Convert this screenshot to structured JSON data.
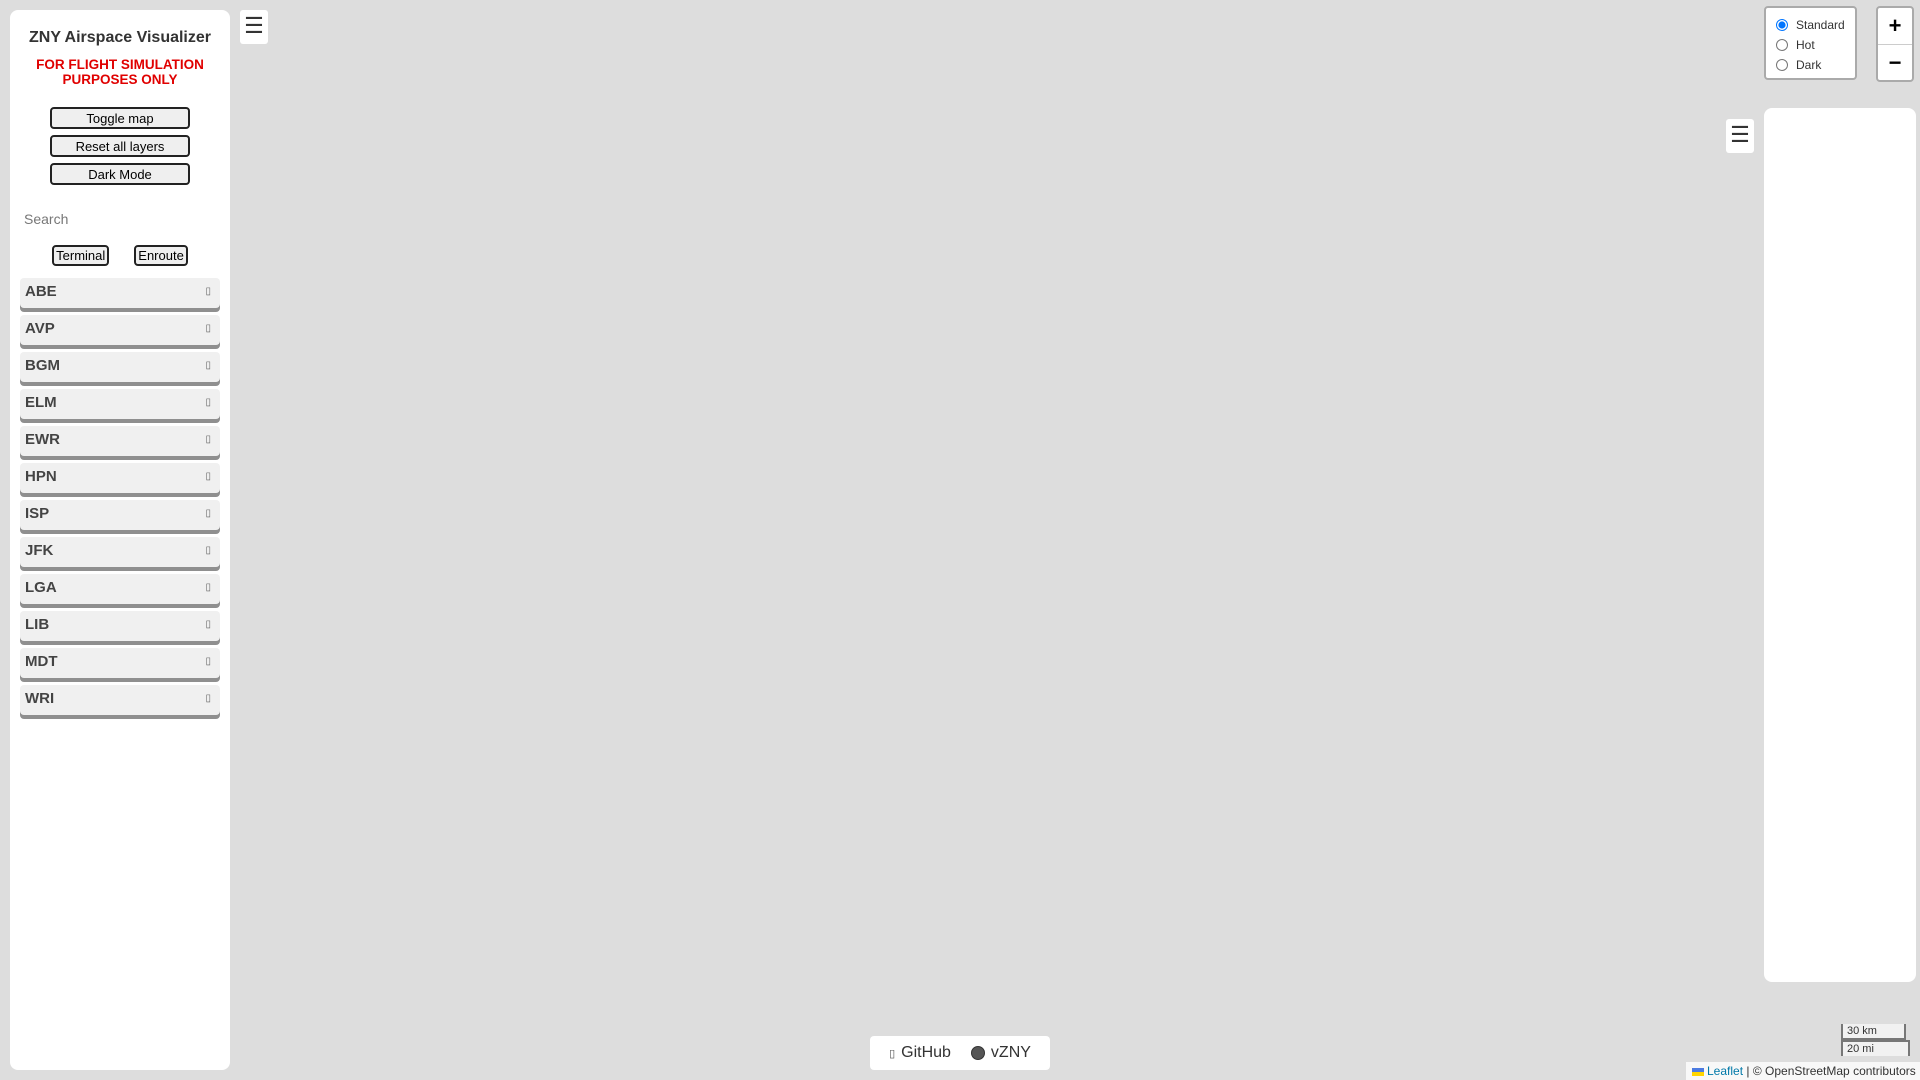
{
  "sidebar": {
    "title": "ZNY Airspace Visualizer",
    "disclaimer": "FOR FLIGHT SIMULATION PURPOSES ONLY",
    "buttons": {
      "toggle_map": "Toggle map",
      "reset_layers": "Reset all layers",
      "dark_mode": "Dark Mode"
    },
    "search": {
      "placeholder": "Search"
    },
    "filters": {
      "terminal": "Terminal",
      "enroute": "Enroute"
    },
    "facilities": [
      {
        "label": "ABE"
      },
      {
        "label": "AVP"
      },
      {
        "label": "BGM"
      },
      {
        "label": "ELM"
      },
      {
        "label": "EWR"
      },
      {
        "label": "HPN"
      },
      {
        "label": "ISP"
      },
      {
        "label": "JFK"
      },
      {
        "label": "LGA"
      },
      {
        "label": "LIB"
      },
      {
        "label": "MDT"
      },
      {
        "label": "WRI"
      }
    ],
    "chevron_icon": "chevron-down-icon"
  },
  "hamburger_icon": "☰",
  "layer_control": {
    "options": [
      {
        "label": "Standard",
        "selected": true
      },
      {
        "label": "Hot",
        "selected": false
      },
      {
        "label": "Dark",
        "selected": false
      }
    ]
  },
  "zoom": {
    "in_label": "+",
    "out_label": "−"
  },
  "footer": {
    "github_label": "GitHub",
    "vzny_label": "vZNY"
  },
  "scale": {
    "km_label": "30 km",
    "mi_label": "20 mi"
  },
  "attribution": {
    "leaflet_label": "Leaflet",
    "separator": "|",
    "osm_text": "© OpenStreetMap contributors"
  },
  "colors": {
    "map_background": "#dddddd",
    "disclaimer": "#e00000",
    "link": "#0078a8"
  }
}
